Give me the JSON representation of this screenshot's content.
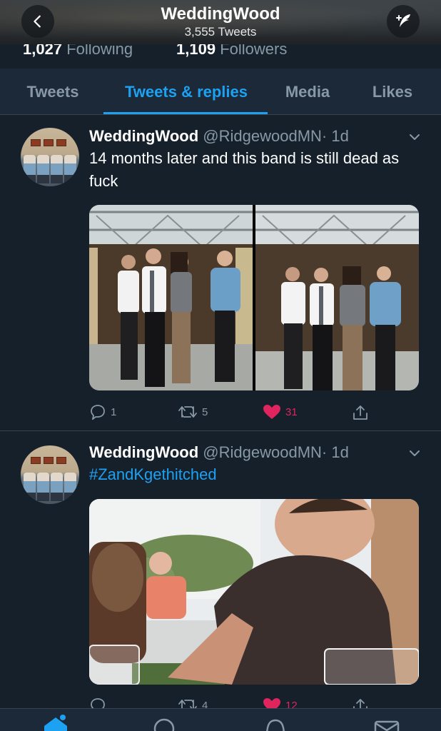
{
  "header": {
    "title": "WeddingWood",
    "subtitle": "3,555 Tweets"
  },
  "stats": {
    "following_count": "1,027",
    "following_label": "Following",
    "followers_count": "1,109",
    "followers_label": "Followers"
  },
  "tabs": [
    {
      "label": "Tweets"
    },
    {
      "label": "Tweets & replies",
      "active": true
    },
    {
      "label": "Media"
    },
    {
      "label": "Likes"
    }
  ],
  "tweets": [
    {
      "name": "WeddingWood",
      "handle": "@RidgewoodMN",
      "time": "· 1d",
      "text": "14 months later and this band is still dead as fuck",
      "replies": "1",
      "retweets": "5",
      "likes": "31"
    },
    {
      "name": "WeddingWood",
      "handle": "@RidgewoodMN",
      "time": "· 1d",
      "text": "#ZandKgethitched",
      "replies": "",
      "retweets": "4",
      "likes": "12"
    }
  ],
  "colors": {
    "background": "#15202b",
    "accent": "#1da1f2",
    "like": "#e0245e",
    "muted": "#8899a6"
  },
  "icons": [
    "back-arrow-icon",
    "compose-tweet-icon",
    "caret-down-icon",
    "reply-icon",
    "retweet-icon",
    "heart-icon",
    "share-icon",
    "home-icon",
    "search-icon",
    "notifications-icon",
    "messages-icon"
  ]
}
